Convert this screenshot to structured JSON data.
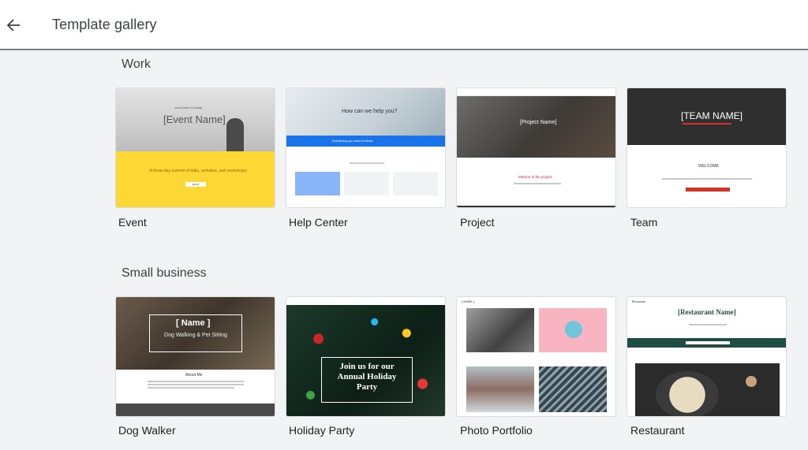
{
  "header": {
    "title": "Template gallery",
    "back_icon": "arrow-left-icon"
  },
  "sections": [
    {
      "title": "Work",
      "templates": [
        {
          "label": "Event",
          "preview": {
            "heading": "[Event Name]",
            "subheading": "Your Event In Detail",
            "tagline": "A three-day summit of talks, activities, and workshops",
            "button": "RSVP"
          }
        },
        {
          "label": "Help Center",
          "preview": {
            "heading": "How can we help you?",
            "banner": "Everything you need to know"
          }
        },
        {
          "label": "Project",
          "preview": {
            "heading": "[Project Name]",
            "subheading": "Mission of the project"
          }
        },
        {
          "label": "Team",
          "preview": {
            "heading": "[TEAM NAME]",
            "subheading": "WELCOME"
          }
        }
      ]
    },
    {
      "title": "Small business",
      "templates": [
        {
          "label": "Dog Walker",
          "preview": {
            "heading": "[ Name ]",
            "subheading": "Dog Walking & Pet Sitting",
            "section": "About Me"
          }
        },
        {
          "label": "Holiday Party",
          "preview": {
            "heading": "Join us for our Annual Holiday Party"
          }
        },
        {
          "label": "Photo Portfolio",
          "preview": {
            "heading": "[ NAME ]"
          }
        },
        {
          "label": "Restaurant",
          "preview": {
            "heading": "[Restaurant Name]",
            "brand": "Restaurant"
          }
        }
      ]
    }
  ],
  "colors": {
    "event_yellow": "#fdd835",
    "help_blue": "#1a73e8",
    "team_red": "#d93025",
    "restaurant_green": "#1e4d45"
  }
}
